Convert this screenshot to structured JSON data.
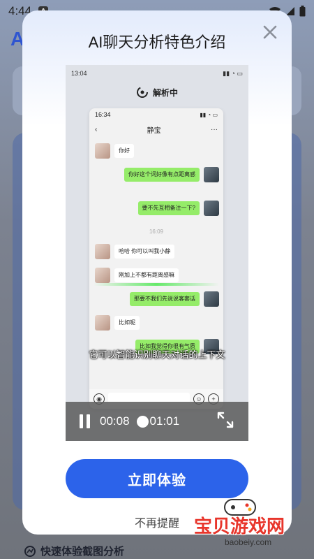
{
  "statusbar": {
    "time": "4:44",
    "notif_icon": "A"
  },
  "modal": {
    "title": "AI聊天分析特色介绍",
    "cta_label": "立即体验",
    "dismiss_label": "不再提醒"
  },
  "video": {
    "phone_time": "13:04",
    "analyzing_label": "解析中",
    "inner_time": "16:34",
    "chat_name": "静宝",
    "messages": [
      {
        "side": "left",
        "text": "你好"
      },
      {
        "side": "right",
        "text": "你好这个词好像有点距离感"
      },
      {
        "side": "right",
        "text": "要不先互相备注一下?"
      },
      {
        "side": "left",
        "text": "哈哈 你可以叫我小静"
      },
      {
        "side": "left",
        "text": "刚加上不都有距离感嘛"
      },
      {
        "side": "right",
        "text": "那要不我们先说说客套话"
      },
      {
        "side": "left",
        "text": "比如呢"
      },
      {
        "side": "right",
        "text": "比如我觉得你很有气质"
      }
    ],
    "timestamp": "16:09",
    "subtitle": "它可以智能识别聊天对话的上下文",
    "current_time": "00:08",
    "total_time": "01:01",
    "progress": 0.13
  },
  "background": {
    "bottom_label": "快速体验截图分析"
  },
  "watermark": {
    "name": "宝贝游戏网",
    "url": "baobeiy.com"
  }
}
